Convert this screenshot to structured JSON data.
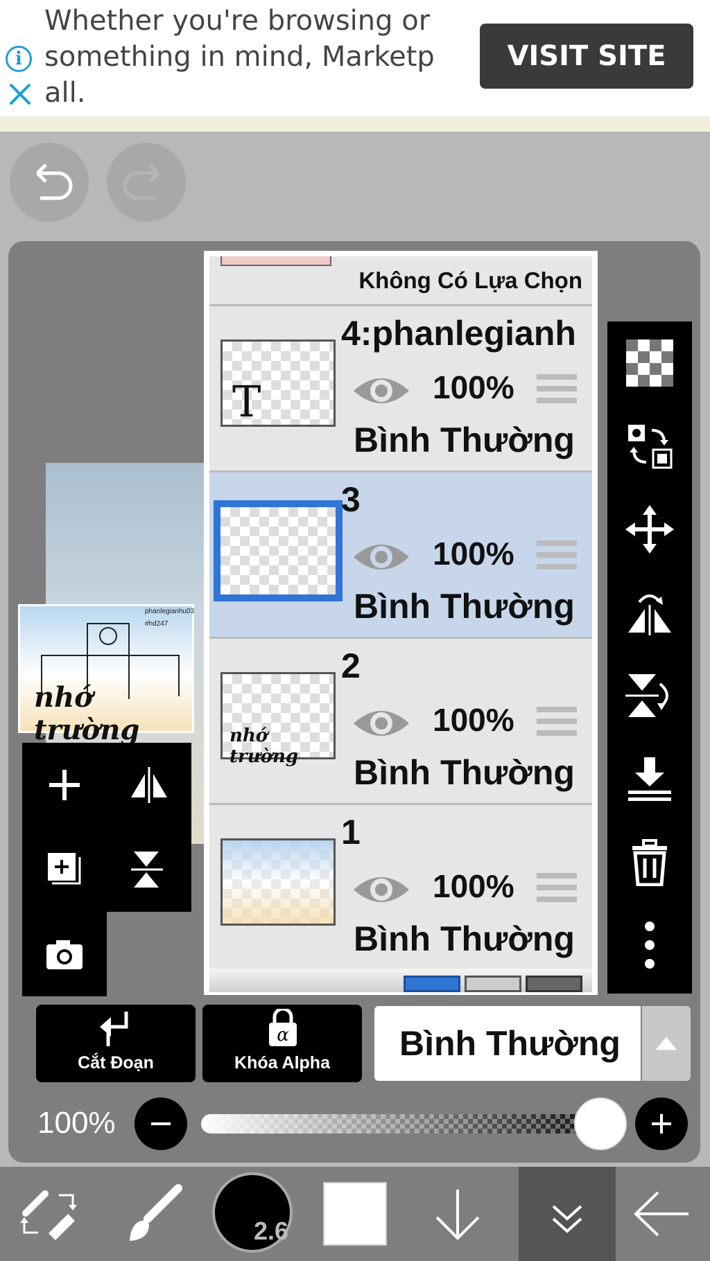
{
  "ad": {
    "text": "Whether you're browsing or\nsomething in mind, Marketp\nall.",
    "cta": "VISIT SITE",
    "info_icon": "info-icon",
    "close_icon": "close-icon"
  },
  "toolbar_top": {
    "undo_icon": "undo-icon",
    "redo_icon": "redo-icon"
  },
  "preview": {
    "watermark_line1": "phanlegianhu03",
    "watermark_line2": "#hd247",
    "handwriting": "nhớ trường"
  },
  "layers": {
    "no_selection_label": "Không Có Lựa Chọn",
    "items": [
      {
        "name": "4:phanlegianh",
        "opacity": "100%",
        "blend": "Bình Thường",
        "selected": false,
        "thumb": "text"
      },
      {
        "name": "3",
        "opacity": "100%",
        "blend": "Bình Thường",
        "selected": true,
        "thumb": "empty"
      },
      {
        "name": "2",
        "opacity": "100%",
        "blend": "Bình Thường",
        "selected": false,
        "thumb": "handwriting"
      },
      {
        "name": "1",
        "opacity": "100%",
        "blend": "Bình Thường",
        "selected": false,
        "thumb": "sky"
      }
    ],
    "thumb_text_glyph": "T",
    "thumb_handwriting": "nhớ trường"
  },
  "left_tools": [
    "add-layer-icon",
    "flip-horizontal-icon",
    "copy-layer-icon",
    "flip-vertical-icon",
    "camera-icon"
  ],
  "right_tools": [
    "transparency-icon",
    "swap-layer-icon",
    "move-icon",
    "rotate-flip-horizontal-icon",
    "rotate-flip-vertical-icon",
    "merge-down-icon",
    "trash-icon",
    "more-options-icon"
  ],
  "actions": {
    "clip_label": "Cắt Đoạn",
    "alpha_lock_label": "Khóa Alpha",
    "blend_mode": "Bình Thường"
  },
  "opacity": {
    "label": "100%",
    "value": 1.0
  },
  "bottom_bar": {
    "brush_size": "2.6",
    "primary_color": "#ffffff",
    "items": [
      "swap-tools-icon",
      "brush-icon",
      "brush-size",
      "color-swatch",
      "arrow-down-icon",
      "layers-collapse-icon",
      "back-arrow-icon"
    ]
  },
  "colors": {
    "selection_blue": "#2f74d6",
    "selected_row": "#c7d6ea",
    "panel_gray": "#7e7e7e"
  }
}
